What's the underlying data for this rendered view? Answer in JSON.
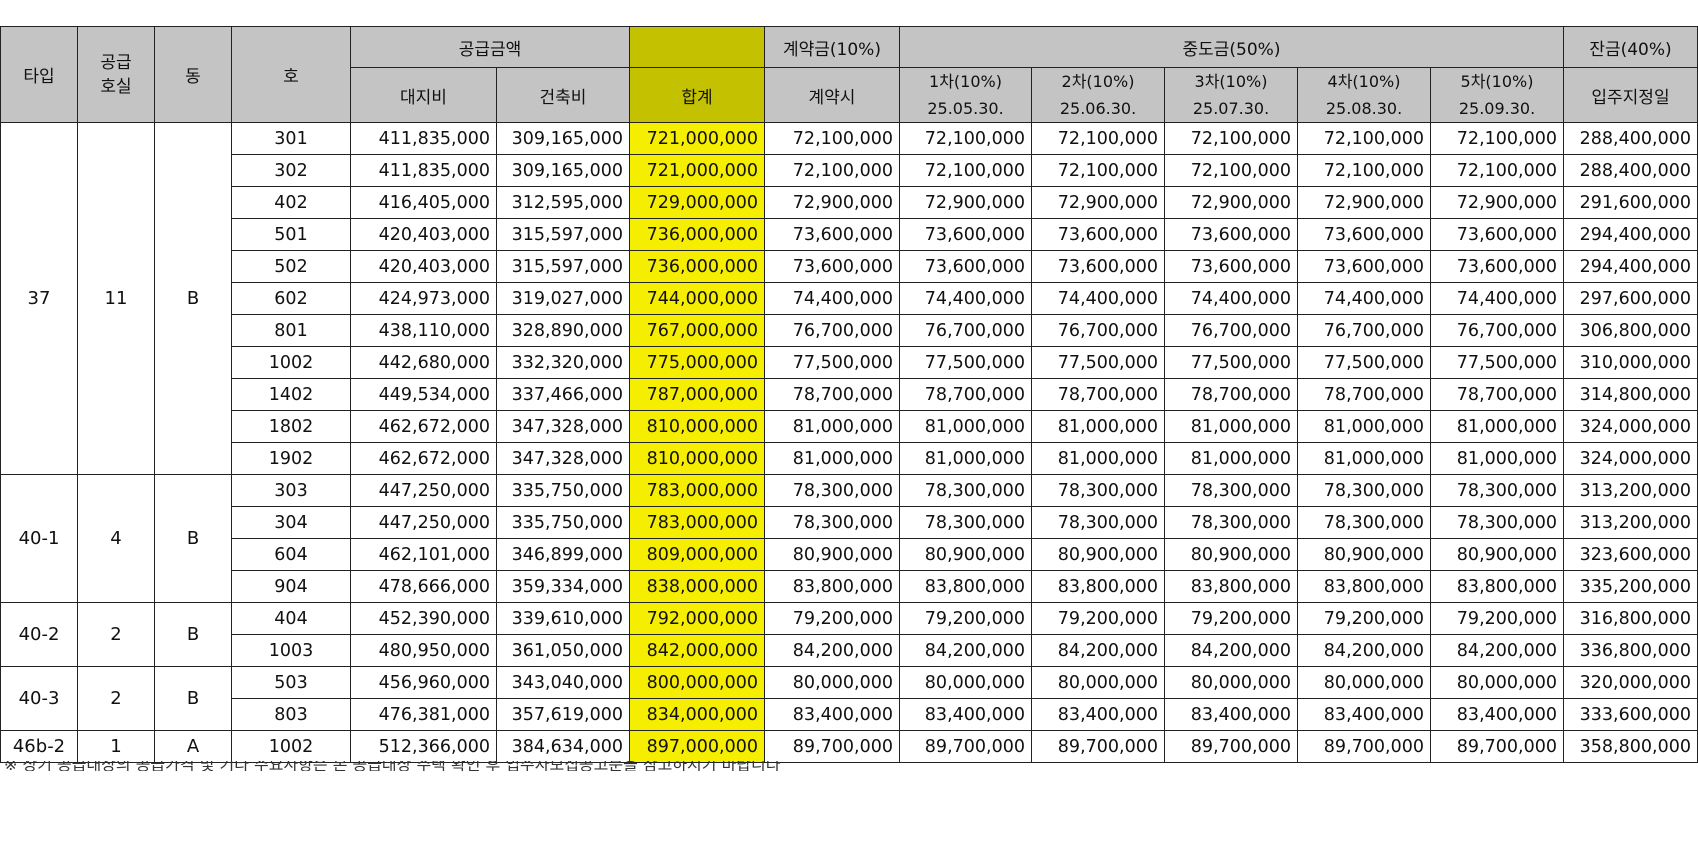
{
  "headers": {
    "type": "타입",
    "supply_rooms": "공급\n호실",
    "dong": "동",
    "ho": "호",
    "supply_amount": "공급금액",
    "land": "대지비",
    "building": "건축비",
    "total": "합계",
    "contract": "계약금(10%)",
    "contract_sub": "계약시",
    "middle": "중도금(50%)",
    "installments": [
      {
        "label": "1차(10%)",
        "date": "25.05.30."
      },
      {
        "label": "2차(10%)",
        "date": "25.06.30."
      },
      {
        "label": "3차(10%)",
        "date": "25.07.30."
      },
      {
        "label": "4차(10%)",
        "date": "25.08.30."
      },
      {
        "label": "5차(10%)",
        "date": "25.09.30."
      }
    ],
    "balance": "잔금(40%)",
    "balance_sub": "입주지정일"
  },
  "highlight_color": "#f6ee00",
  "groups": [
    {
      "type": "37",
      "supply": "11",
      "dong": "B",
      "rows": [
        [
          "301",
          "411,835,000",
          "309,165,000",
          "721,000,000",
          "72,100,000",
          "72,100,000",
          "72,100,000",
          "72,100,000",
          "72,100,000",
          "72,100,000",
          "288,400,000"
        ],
        [
          "302",
          "411,835,000",
          "309,165,000",
          "721,000,000",
          "72,100,000",
          "72,100,000",
          "72,100,000",
          "72,100,000",
          "72,100,000",
          "72,100,000",
          "288,400,000"
        ],
        [
          "402",
          "416,405,000",
          "312,595,000",
          "729,000,000",
          "72,900,000",
          "72,900,000",
          "72,900,000",
          "72,900,000",
          "72,900,000",
          "72,900,000",
          "291,600,000"
        ],
        [
          "501",
          "420,403,000",
          "315,597,000",
          "736,000,000",
          "73,600,000",
          "73,600,000",
          "73,600,000",
          "73,600,000",
          "73,600,000",
          "73,600,000",
          "294,400,000"
        ],
        [
          "502",
          "420,403,000",
          "315,597,000",
          "736,000,000",
          "73,600,000",
          "73,600,000",
          "73,600,000",
          "73,600,000",
          "73,600,000",
          "73,600,000",
          "294,400,000"
        ],
        [
          "602",
          "424,973,000",
          "319,027,000",
          "744,000,000",
          "74,400,000",
          "74,400,000",
          "74,400,000",
          "74,400,000",
          "74,400,000",
          "74,400,000",
          "297,600,000"
        ],
        [
          "801",
          "438,110,000",
          "328,890,000",
          "767,000,000",
          "76,700,000",
          "76,700,000",
          "76,700,000",
          "76,700,000",
          "76,700,000",
          "76,700,000",
          "306,800,000"
        ],
        [
          "1002",
          "442,680,000",
          "332,320,000",
          "775,000,000",
          "77,500,000",
          "77,500,000",
          "77,500,000",
          "77,500,000",
          "77,500,000",
          "77,500,000",
          "310,000,000"
        ],
        [
          "1402",
          "449,534,000",
          "337,466,000",
          "787,000,000",
          "78,700,000",
          "78,700,000",
          "78,700,000",
          "78,700,000",
          "78,700,000",
          "78,700,000",
          "314,800,000"
        ],
        [
          "1802",
          "462,672,000",
          "347,328,000",
          "810,000,000",
          "81,000,000",
          "81,000,000",
          "81,000,000",
          "81,000,000",
          "81,000,000",
          "81,000,000",
          "324,000,000"
        ],
        [
          "1902",
          "462,672,000",
          "347,328,000",
          "810,000,000",
          "81,000,000",
          "81,000,000",
          "81,000,000",
          "81,000,000",
          "81,000,000",
          "81,000,000",
          "324,000,000"
        ]
      ]
    },
    {
      "type": "40-1",
      "supply": "4",
      "dong": "B",
      "rows": [
        [
          "303",
          "447,250,000",
          "335,750,000",
          "783,000,000",
          "78,300,000",
          "78,300,000",
          "78,300,000",
          "78,300,000",
          "78,300,000",
          "78,300,000",
          "313,200,000"
        ],
        [
          "304",
          "447,250,000",
          "335,750,000",
          "783,000,000",
          "78,300,000",
          "78,300,000",
          "78,300,000",
          "78,300,000",
          "78,300,000",
          "78,300,000",
          "313,200,000"
        ],
        [
          "604",
          "462,101,000",
          "346,899,000",
          "809,000,000",
          "80,900,000",
          "80,900,000",
          "80,900,000",
          "80,900,000",
          "80,900,000",
          "80,900,000",
          "323,600,000"
        ],
        [
          "904",
          "478,666,000",
          "359,334,000",
          "838,000,000",
          "83,800,000",
          "83,800,000",
          "83,800,000",
          "83,800,000",
          "83,800,000",
          "83,800,000",
          "335,200,000"
        ]
      ]
    },
    {
      "type": "40-2",
      "supply": "2",
      "dong": "B",
      "rows": [
        [
          "404",
          "452,390,000",
          "339,610,000",
          "792,000,000",
          "79,200,000",
          "79,200,000",
          "79,200,000",
          "79,200,000",
          "79,200,000",
          "79,200,000",
          "316,800,000"
        ],
        [
          "1003",
          "480,950,000",
          "361,050,000",
          "842,000,000",
          "84,200,000",
          "84,200,000",
          "84,200,000",
          "84,200,000",
          "84,200,000",
          "84,200,000",
          "336,800,000"
        ]
      ]
    },
    {
      "type": "40-3",
      "supply": "2",
      "dong": "B",
      "rows": [
        [
          "503",
          "456,960,000",
          "343,040,000",
          "800,000,000",
          "80,000,000",
          "80,000,000",
          "80,000,000",
          "80,000,000",
          "80,000,000",
          "80,000,000",
          "320,000,000"
        ],
        [
          "803",
          "476,381,000",
          "357,619,000",
          "834,000,000",
          "83,400,000",
          "83,400,000",
          "83,400,000",
          "83,400,000",
          "83,400,000",
          "83,400,000",
          "333,600,000"
        ]
      ]
    },
    {
      "type": "46b-2",
      "supply": "1",
      "dong": "A",
      "rows": [
        [
          "1002",
          "512,366,000",
          "384,634,000",
          "897,000,000",
          "89,700,000",
          "89,700,000",
          "89,700,000",
          "89,700,000",
          "89,700,000",
          "89,700,000",
          "358,800,000"
        ]
      ]
    }
  ],
  "footnote": "※ 상기 공급대상의 공급가격 및 기타 주요사항은 본 공급대상 주택 확인 후 입주자모집공고문을 참고하시기 바랍니다"
}
